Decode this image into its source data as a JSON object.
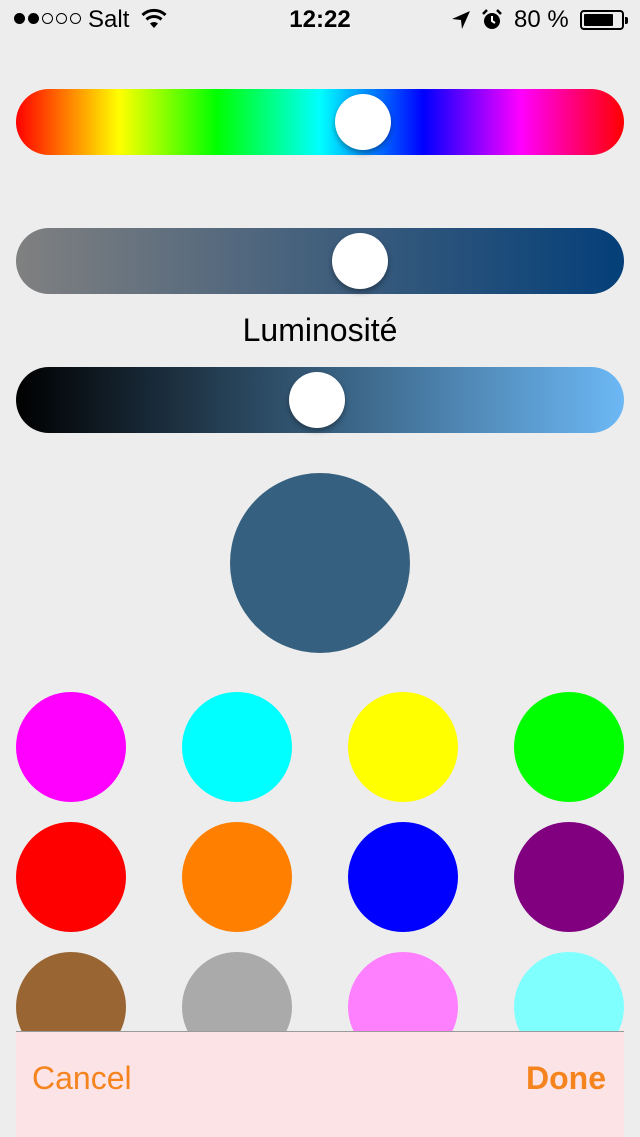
{
  "status_bar": {
    "carrier": "Salt",
    "signal_strength": 2,
    "signal_max": 5,
    "time": "12:22",
    "battery_percent": "80 %",
    "battery_level": 0.8
  },
  "hue_slider": {
    "value": 0.57
  },
  "saturation_slider": {
    "value": 0.565,
    "start_color": "#808080",
    "end_color": "#043f79"
  },
  "luminosity": {
    "label": "Luminosité",
    "value": 0.495,
    "start_color": "#000000",
    "end_color": "#6cb8f5"
  },
  "preview_color": "#36607f",
  "swatches": [
    "#ff00ff",
    "#00ffff",
    "#ffff00",
    "#00ff00",
    "#ff0000",
    "#ff8000",
    "#0000ff",
    "#800080",
    "#996633",
    "#aaaaaa",
    "#ff80ff",
    "#80ffff"
  ],
  "toolbar": {
    "cancel_label": "Cancel",
    "done_label": "Done"
  },
  "accent_color": "#f5841f"
}
